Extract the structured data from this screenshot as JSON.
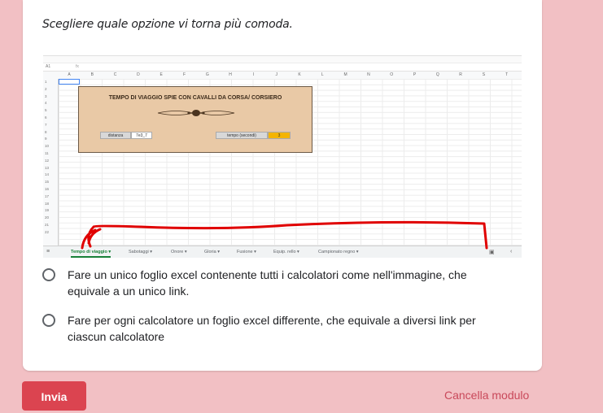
{
  "question": "Scegliere quale opzione vi torna più comoda.",
  "sheet": {
    "cell_ref": "A1",
    "fx": "fx",
    "columns": [
      "A",
      "B",
      "C",
      "D",
      "E",
      "F",
      "G",
      "H",
      "I",
      "J",
      "K",
      "L",
      "M",
      "N",
      "O",
      "P",
      "Q",
      "R",
      "S",
      "T"
    ],
    "rows": [
      "1",
      "2",
      "3",
      "4",
      "5",
      "6",
      "7",
      "8",
      "9",
      "10",
      "11",
      "12",
      "13",
      "14",
      "15",
      "16",
      "17",
      "18",
      "19",
      "20",
      "21",
      "22"
    ],
    "panel_title": "TEMPO DI VIAGGIO SPIE CON CAVALLI DA CORSA/ CORSIERO",
    "distance_label": "distanza",
    "distance_value": "7e3_7",
    "time_label": "tempo (secondi)",
    "time_value": "3",
    "tabs": [
      "Tempo di viaggio ▾",
      "Sabotaggi ▾",
      "Onore ▾",
      "Gloria ▾",
      "Fusione ▾",
      "Equip. rello ▾",
      "Campionato regno ▾"
    ],
    "active_tab": 0,
    "annotation_color": "#e00000"
  },
  "options": [
    {
      "text": "Fare un unico foglio excel contenente tutti i calcolatori come nell'immagine, che equivale a un unico link."
    },
    {
      "text": "Fare per ogni calcolatore un foglio excel differente, che equivale a diversi link per ciascun calcolatore"
    }
  ],
  "submit_label": "Invia",
  "clear_label": "Cancella modulo",
  "colors": {
    "background": "#f2c0c4",
    "submit": "#db4450",
    "clear": "#c9485a"
  }
}
